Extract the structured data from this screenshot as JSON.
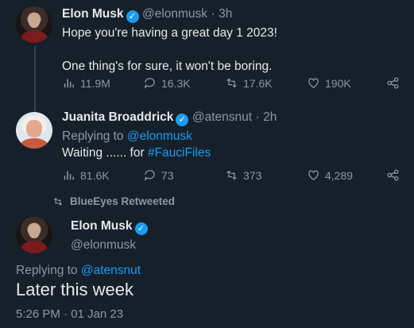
{
  "tweet1": {
    "name": "Elon Musk",
    "handle": "@elonmusk",
    "sep": "·",
    "time": "3h",
    "line1": "Hope you're having a great day 1 2023!",
    "line2": "One thing's for sure, it won't be boring.",
    "views": "11.9M",
    "replies": "16.3K",
    "retweets": "17.6K",
    "likes": "190K"
  },
  "tweet2": {
    "name": "Juanita Broaddrick",
    "handle": "@atensnut",
    "sep": "·",
    "time": "2h",
    "replying_prefix": "Replying to",
    "replying_to": "@elonmusk",
    "text_prefix": "Waiting ...... for",
    "hashtag": "#FauciFiles",
    "views": "81.6K",
    "replies": "73",
    "retweets": "373",
    "likes": "4,289"
  },
  "retweeted_by": "BlueEyes Retweeted",
  "tweet3": {
    "name": "Elon Musk",
    "handle": "@elonmusk",
    "replying_prefix": "Replying to",
    "replying_to": "@atensnut",
    "text": "Later this week",
    "timestamp": "5:26 PM · 01 Jan 23"
  },
  "colors": {
    "background": "#15202b",
    "accent": "#1d9bf0",
    "muted": "#8b98a5"
  }
}
